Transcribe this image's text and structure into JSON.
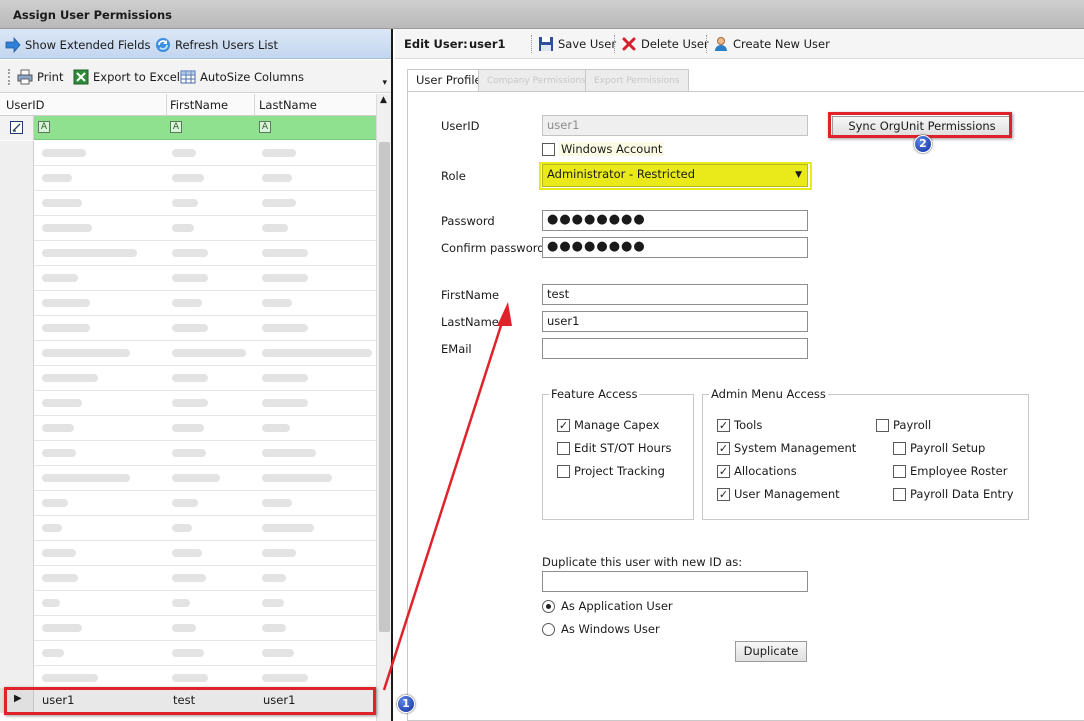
{
  "window": {
    "title": "Assign User Permissions"
  },
  "left_toolbar": {
    "show_extended_fields": "Show Extended Fields",
    "refresh_users_list": "Refresh Users List",
    "print": "Print",
    "export_to_excel": "Export to Excel",
    "autosize_columns": "AutoSize Columns"
  },
  "grid": {
    "columns": [
      "UserID",
      "FirstName",
      "LastName"
    ],
    "filter_glyph": "A",
    "selected_row": {
      "userid": "user1",
      "firstname": "test",
      "lastname": "user1"
    }
  },
  "edit_header": {
    "label": "Edit User:",
    "user": "user1",
    "save": "Save User",
    "delete": "Delete User",
    "create": "Create New User"
  },
  "tabs": [
    {
      "label": "User Profile",
      "active": true
    },
    {
      "label": "Company Permissions",
      "active": false
    },
    {
      "label": "Export Permissions",
      "active": false
    }
  ],
  "profile": {
    "userid_label": "UserID",
    "userid_value": "user1",
    "sync_button": "Sync OrgUnit Permissions",
    "windows_account_label": "Windows Account",
    "role_label": "Role",
    "role_value": "Administrator - Restricted",
    "password_label": "Password",
    "password_value": "●●●●●●●●",
    "confirm_password_label": "Confirm password",
    "confirm_password_value": "●●●●●●●●",
    "firstname_label": "FirstName",
    "firstname_value": "test",
    "lastname_label": "LastName",
    "lastname_value": "user1",
    "email_label": "EMail",
    "email_value": ""
  },
  "feature_access": {
    "title": "Feature Access",
    "items": [
      {
        "label": "Manage Capex",
        "checked": true
      },
      {
        "label": "Edit ST/OT Hours",
        "checked": false
      },
      {
        "label": "Project Tracking",
        "checked": false
      }
    ]
  },
  "admin_menu": {
    "title": "Admin Menu Access",
    "left": [
      {
        "label": "Tools",
        "checked": true
      },
      {
        "label": "System Management",
        "checked": true
      },
      {
        "label": "Allocations",
        "checked": true
      },
      {
        "label": "User Management",
        "checked": true
      }
    ],
    "right": [
      {
        "label": "Payroll",
        "checked": false
      },
      {
        "label": "Payroll Setup",
        "checked": false
      },
      {
        "label": "Employee Roster",
        "checked": false
      },
      {
        "label": "Payroll Data Entry",
        "checked": false
      }
    ]
  },
  "duplicate": {
    "label": "Duplicate this user with new ID as:",
    "value": "",
    "as_app_user": "As Application User",
    "as_windows_user": "As Windows User",
    "button": "Duplicate"
  },
  "annotations": {
    "badge1": "1",
    "badge2": "2"
  },
  "colors": {
    "highlight_red": "#e0232b",
    "role_yellow": "#eaea1a",
    "filter_green": "#8fe08f",
    "badge_blue": "#1a3fb5"
  }
}
